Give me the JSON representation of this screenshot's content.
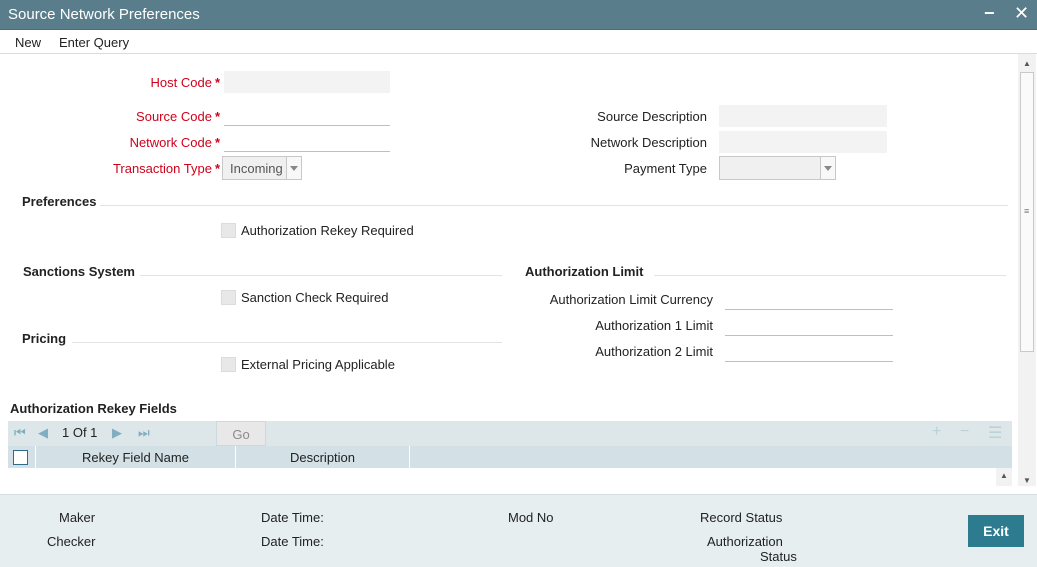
{
  "window": {
    "title": "Source Network Preferences",
    "minimize_glyph": "−",
    "close_glyph": "✕"
  },
  "menu": {
    "new": "New",
    "enter_query": "Enter Query"
  },
  "form": {
    "host_code": {
      "label": "Host Code",
      "value": ""
    },
    "source_code": {
      "label": "Source Code",
      "value": ""
    },
    "network_code": {
      "label": "Network Code",
      "value": ""
    },
    "transaction_type": {
      "label": "Transaction Type",
      "value": "Incoming"
    },
    "source_description": {
      "label": "Source Description",
      "value": ""
    },
    "network_description": {
      "label": "Network Description",
      "value": ""
    },
    "payment_type": {
      "label": "Payment Type",
      "value": ""
    },
    "required_marker": "*"
  },
  "preferences": {
    "heading": "Preferences",
    "authorization_rekey_required": "Authorization Rekey Required"
  },
  "sanctions": {
    "heading": "Sanctions System",
    "sanction_check_required": "Sanction Check Required"
  },
  "pricing": {
    "heading": "Pricing",
    "external_pricing_applicable": "External Pricing Applicable"
  },
  "authorization_limit": {
    "heading": "Authorization Limit",
    "currency_label": "Authorization Limit Currency",
    "limit1_label": "Authorization 1 Limit",
    "limit2_label": "Authorization 2 Limit"
  },
  "rekey_grid": {
    "heading": "Authorization Rekey Fields",
    "pager": "1 Of 1",
    "go_label": "Go",
    "columns": [
      "Rekey Field Name",
      "Description"
    ],
    "icons": [
      "first-page-icon",
      "prev-page-icon",
      "next-page-icon",
      "last-page-icon",
      "add-row-icon",
      "delete-row-icon",
      "list-icon"
    ]
  },
  "footer": {
    "maker": "Maker",
    "checker": "Checker",
    "date_time_1": "Date Time:",
    "date_time_2": "Date Time:",
    "mod_no": "Mod No",
    "record_status": "Record Status",
    "authorization_status_line1": "Authorization",
    "authorization_status_line2": "Status",
    "exit": "Exit"
  },
  "colors": {
    "titlebar": "#5a7d8b",
    "required_label": "#d0021b",
    "grid_header": "#d3e0e5",
    "footer_bg": "#e6eef0",
    "exit_button": "#2d7b8e"
  }
}
